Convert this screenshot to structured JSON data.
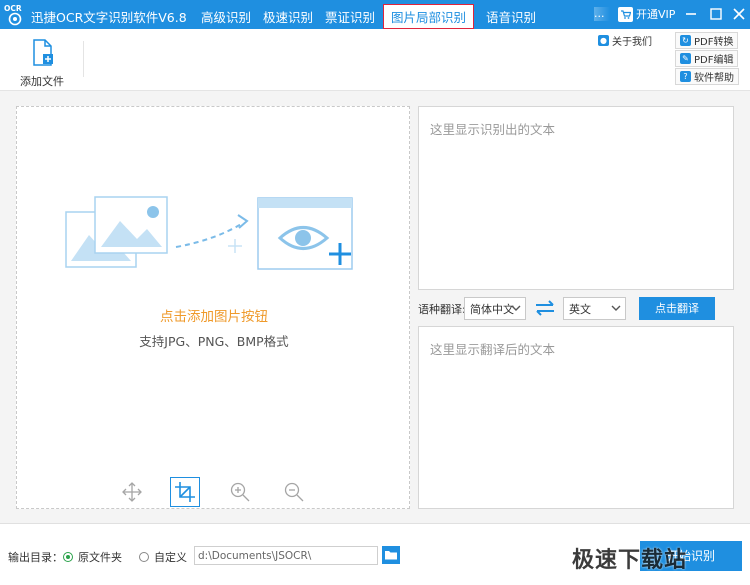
{
  "title_bar": {
    "logo_text": "OCR",
    "app_title": "迅捷OCR文字识别软件V6.8",
    "tabs": [
      {
        "label": "高级识别"
      },
      {
        "label": "极速识别"
      },
      {
        "label": "票证识别"
      },
      {
        "label": "图片局部识别",
        "active": true
      },
      {
        "label": "语音识别"
      }
    ],
    "more": "...",
    "vip_label": "开通VIP",
    "vip_icon": "cart-icon"
  },
  "toolbar": {
    "add_file_label": "添加文件",
    "about_label": "关于我们",
    "side_buttons": [
      {
        "label": "PDF转换",
        "icon": "convert-icon"
      },
      {
        "label": "PDF编辑",
        "icon": "edit-icon"
      },
      {
        "label": "软件帮助",
        "icon": "help-icon"
      }
    ]
  },
  "drop_area": {
    "hint": "点击添加图片按钮",
    "formats": "支持JPG、PNG、BMP格式",
    "tools": [
      "move-icon",
      "crop-icon",
      "zoom-in-icon",
      "zoom-out-icon"
    ]
  },
  "result": {
    "placeholder": "这里显示识别出的文本"
  },
  "translate": {
    "label": "语种翻译:",
    "source_lang": "简体中文",
    "target_lang": "英文",
    "button": "点击翻译",
    "placeholder": "这里显示翻译后的文本"
  },
  "footer": {
    "output_label": "输出目录：",
    "option_original": "原文件夹",
    "option_custom": "自定义",
    "path": "d:\\Documents\\JSOCR\\",
    "start_label": "开始识别",
    "watermark": "极速下载站"
  },
  "colors": {
    "brand_blue": "#1f8fe0",
    "hint_orange": "#ef9a2b",
    "active_tab_border": "#e0243b"
  }
}
